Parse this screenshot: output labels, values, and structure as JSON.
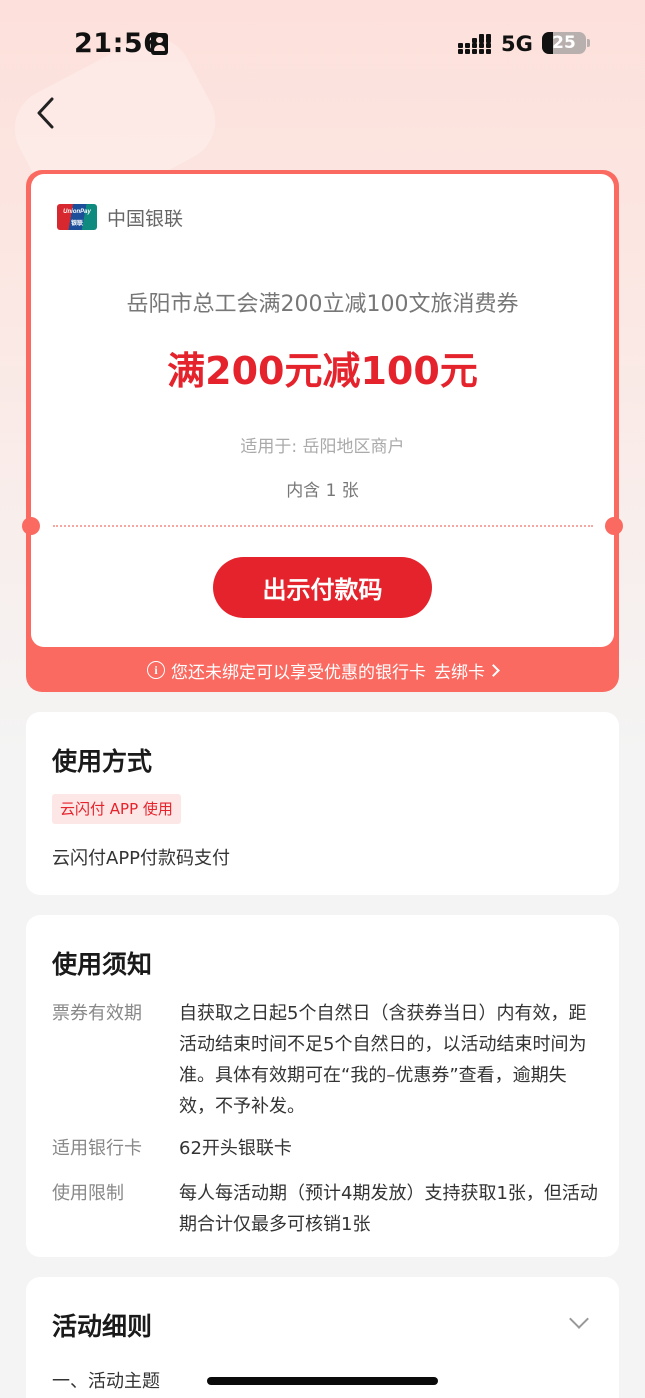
{
  "status_bar": {
    "time": "21:56",
    "network": "5G",
    "battery": "25"
  },
  "coupon": {
    "brand": "中国银联",
    "logo_text": "UnionPay",
    "logo_sub": "银联",
    "title": "岳阳市总工会满200立减100文旅消费券",
    "amount": "满200元减100元",
    "scope": "适用于: 岳阳地区商户",
    "count": "内含 1 张",
    "button_label": "出示付款码",
    "bind_tip": "您还未绑定可以享受优惠的银行卡",
    "bind_link": "去绑卡"
  },
  "usage_method": {
    "title": "使用方式",
    "tag": "云闪付 APP 使用",
    "desc": "云闪付APP付款码支付"
  },
  "usage_notice": {
    "title": "使用须知",
    "rows": [
      {
        "label": "票券有效期",
        "value": "自获取之日起5个自然日（含获券当日）内有效，距活动结束时间不足5个自然日的，以活动结束时间为准。具体有效期可在“我的–优惠券”查看，逾期失效，不予补发。"
      },
      {
        "label": "适用银行卡",
        "value": "62开头银联卡"
      },
      {
        "label": "使用限制",
        "value": "每人每活动期（预计4期发放）支持获取1张，但活动期合计仅最多可核销1张"
      }
    ]
  },
  "activity_rules": {
    "title": "活动细则",
    "first_item": "一、活动主题"
  },
  "colors": {
    "accent": "#e5232c",
    "card_border": "#fa6a61"
  }
}
